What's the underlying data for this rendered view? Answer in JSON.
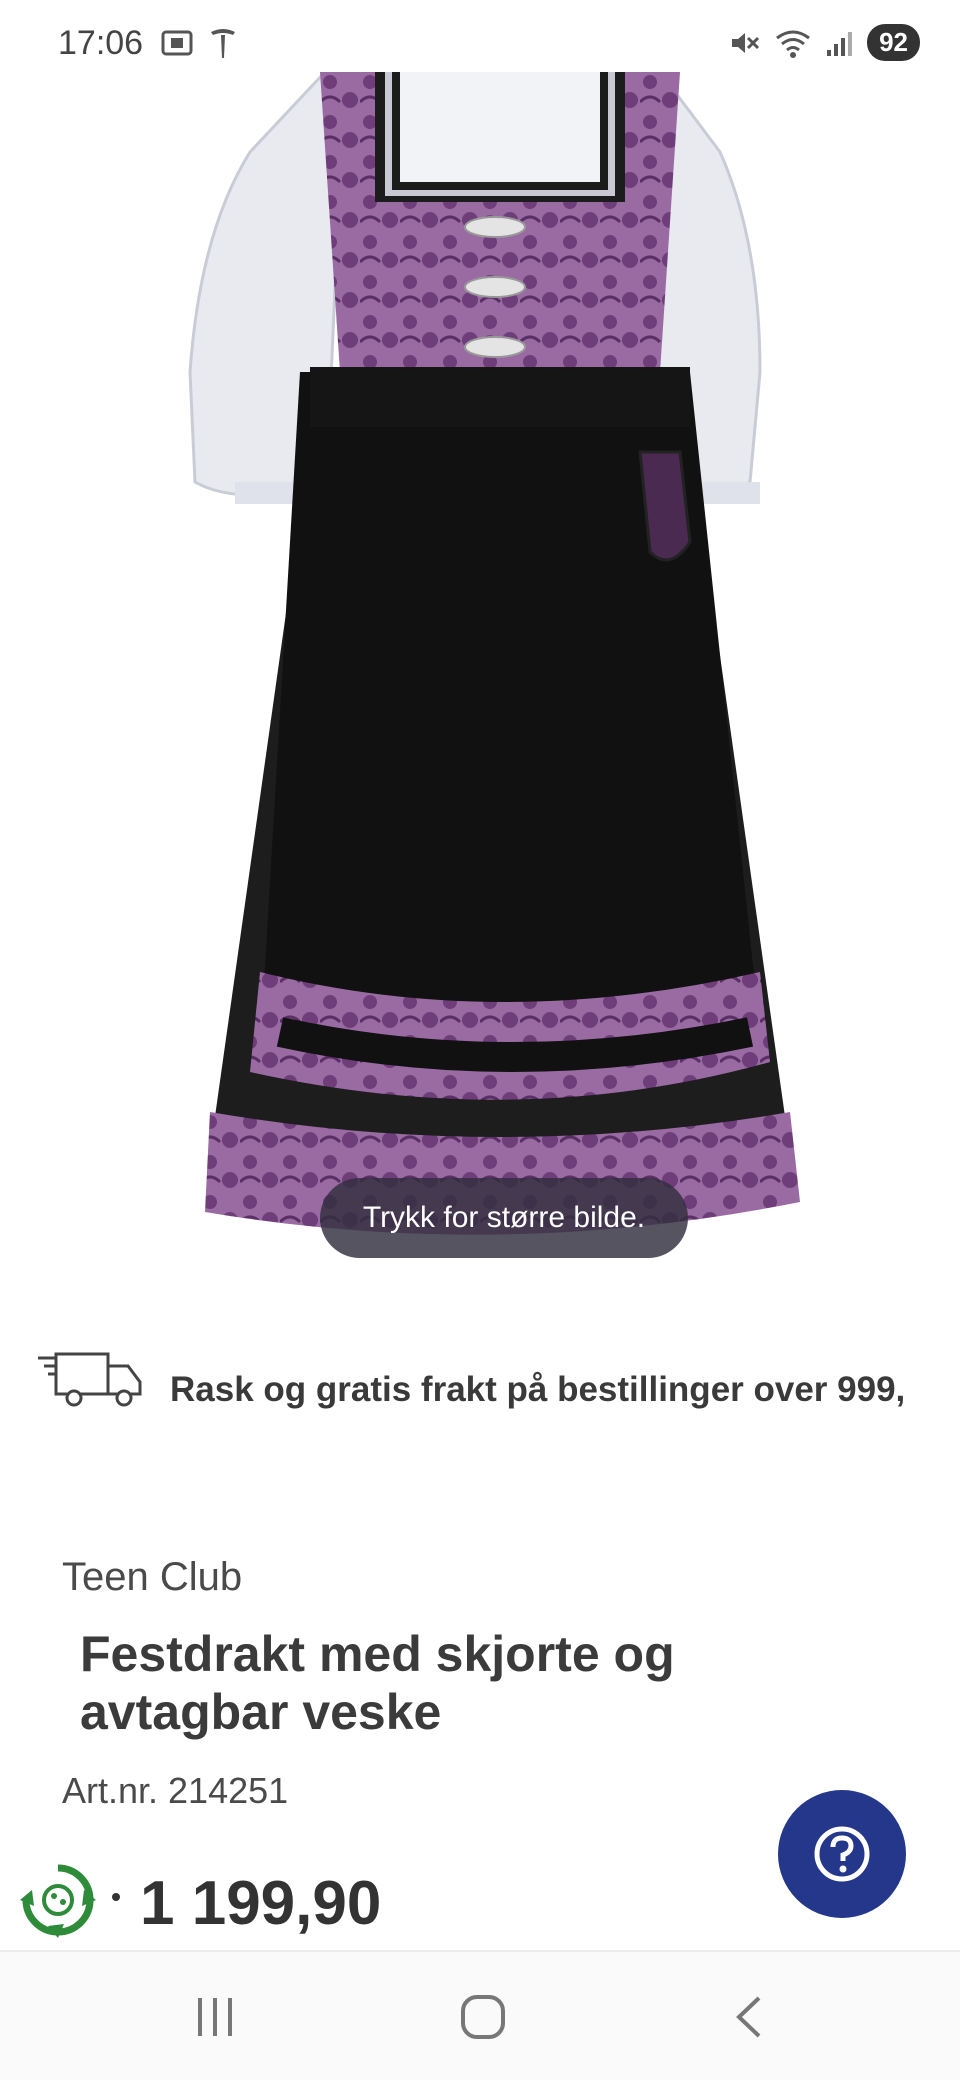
{
  "status_bar": {
    "time": "17:06",
    "battery": "92",
    "icons": [
      "screenshot-icon",
      "tesla-icon",
      "mute-icon",
      "wifi-icon",
      "signal-icon"
    ]
  },
  "product": {
    "image_alt": "Festdrakt med skjorte og avtagbar veske",
    "image_hint": "Trykk for større bilde.",
    "shipping_text": "Rask og gratis frakt på bestillinger over 999,",
    "brand": "Teen Club",
    "title": "Festdrakt med skjorte og avtagbar veske",
    "artnr_label": "Art.nr.",
    "artnr_value": "214251",
    "price": "1 199,90"
  },
  "colors": {
    "accent_blue": "#24378a",
    "eco_green": "#2e8b3a",
    "dress_purple": "#8c5a94",
    "dress_black": "#1a1a1a"
  },
  "nav": {
    "buttons": [
      "recent-apps-icon",
      "home-icon",
      "back-icon"
    ]
  }
}
